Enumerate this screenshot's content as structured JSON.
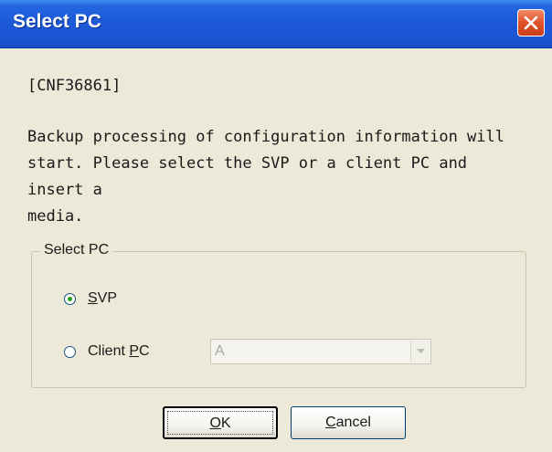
{
  "window": {
    "title": "Select PC"
  },
  "message": {
    "code": "[CNF36861]",
    "text": "Backup processing of configuration information will\nstart. Please select the SVP or a client PC and insert a\nmedia."
  },
  "group": {
    "label": "Select PC",
    "options": [
      {
        "mnemonic": "S",
        "rest": "VP",
        "checked": true
      },
      {
        "prefix": "Client ",
        "mnemonic": "P",
        "rest": "C",
        "checked": false
      }
    ],
    "client_pc_value": "A"
  },
  "buttons": {
    "ok": {
      "mnemonic": "O",
      "rest": "K"
    },
    "cancel": {
      "mnemonic": "C",
      "rest": "ancel"
    }
  },
  "icons": {
    "close": "close-icon",
    "dropdown": "chevron-down-icon"
  },
  "colors": {
    "titlebar": "#1d5ad8",
    "close": "#e0532b",
    "dialog_bg": "#ece9d8"
  }
}
